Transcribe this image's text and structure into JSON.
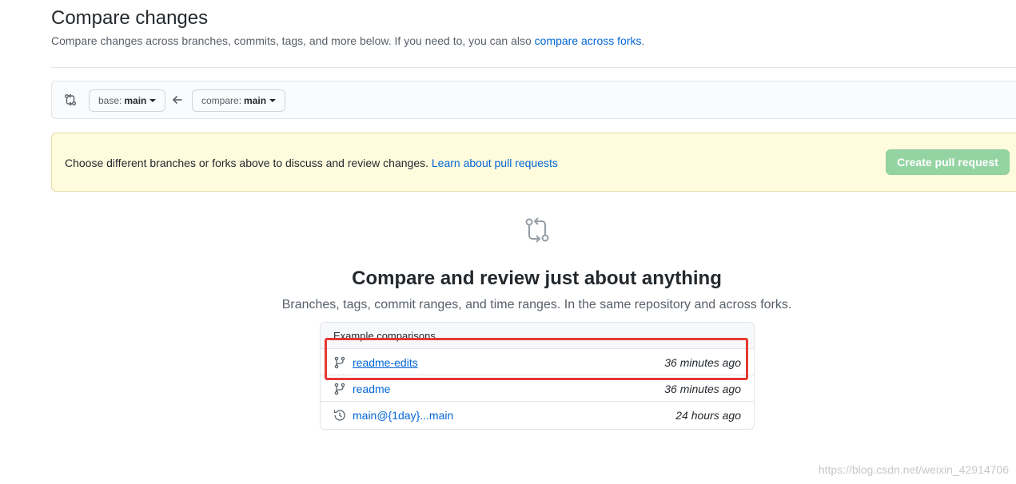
{
  "header": {
    "title": "Compare changes",
    "subtitle": "Compare changes across branches, commits, tags, and more below. If you need to, you can also ",
    "subtitle_link": "compare across forks",
    "subtitle_end": "."
  },
  "range_editor": {
    "base_prefix": "base:",
    "base_branch": "main",
    "compare_prefix": "compare:",
    "compare_branch": "main"
  },
  "flash": {
    "text": "Choose different branches or forks above to discuss and review changes. ",
    "link": "Learn about pull requests",
    "button": "Create pull request"
  },
  "blankslate": {
    "title": "Compare and review just about anything",
    "description": "Branches, tags, commit ranges, and time ranges. In the same repository and across forks."
  },
  "examples": {
    "header": "Example comparisons",
    "rows": [
      {
        "label": "readme-edits",
        "time": "36 minutes ago",
        "icon": "git-branch-icon"
      },
      {
        "label": "readme",
        "time": "36 minutes ago",
        "icon": "git-branch-icon"
      },
      {
        "label": "main@{1day}...main",
        "time": "24 hours ago",
        "icon": "history-icon"
      }
    ]
  },
  "watermark": "https://blog.csdn.net/weixin_42914706",
  "colors": {
    "link": "#0366d6",
    "flash_bg": "#fffbdd",
    "create_pr_bg": "#94d3a2",
    "highlight": "#e53935"
  }
}
